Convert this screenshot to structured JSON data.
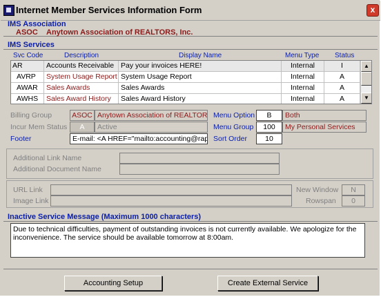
{
  "window": {
    "title": "Internet Member Services Information Form",
    "close_symbol": "x"
  },
  "association": {
    "header": "IMS Association",
    "code": "ASOC",
    "name": "Anytown Association of REALTORS, Inc."
  },
  "services": {
    "header": "IMS Services",
    "columns": {
      "code": "Svc Code",
      "description": "Description",
      "display_name": "Display Name",
      "menu_type": "Menu Type",
      "status": "Status"
    },
    "rows": [
      {
        "code": "AR",
        "description": "Accounts Receivable",
        "display_name": "Pay your invoices HERE!",
        "menu_type": "Internal",
        "status": "I"
      },
      {
        "code": "AVRP",
        "description": "System Usage Report",
        "display_name": "System Usage Report",
        "menu_type": "Internal",
        "status": "A"
      },
      {
        "code": "AWAR",
        "description": "Sales Awards",
        "display_name": "Sales Awards",
        "menu_type": "Internal",
        "status": "A"
      },
      {
        "code": "AWHS",
        "description": "Sales Award History",
        "display_name": "Sales Award History",
        "menu_type": "Internal",
        "status": "A"
      }
    ],
    "selected_index": 0
  },
  "details": {
    "billing_group_label": "Billing Group",
    "billing_group_code": "ASOC",
    "billing_group_name": "Anytown Association of REALTORS, I",
    "incur_label": "Incur Mem Status",
    "incur_code": "A",
    "incur_name": "Active",
    "footer_label": "Footer",
    "footer_value": "E-mail: <A HREF=\"mailto:accounting@rapatton",
    "menu_option_label": "Menu Option",
    "menu_option_value": "B",
    "menu_option_text": "Both",
    "menu_group_label": "Menu Group",
    "menu_group_value": "100",
    "menu_group_text": "My Personal Services",
    "sort_order_label": "Sort Order",
    "sort_order_value": "10"
  },
  "links": {
    "additional_link_label": "Additional Link Name",
    "additional_document_label": "Additional Document Name",
    "url_link_label": "URL Link",
    "image_link_label": "Image Link",
    "new_window_label": "New Window",
    "new_window_value": "N",
    "rowspan_label": "Rowspan",
    "rowspan_value": "0"
  },
  "inactive": {
    "header": "Inactive Service Message (Maximum 1000 characters)",
    "message": "Due to technical difficulties, payment of outstanding invoices is not currently available.  We apologize for the inconvenience.  The service should be available tomorrow at 8:00am."
  },
  "buttons": {
    "accounting_setup": "Accounting Setup",
    "create_external": "Create External Service"
  },
  "colors": {
    "section_header": "#0b1ea8",
    "code_text": "#8b1a1a",
    "window_bg": "#d4d0c8"
  }
}
